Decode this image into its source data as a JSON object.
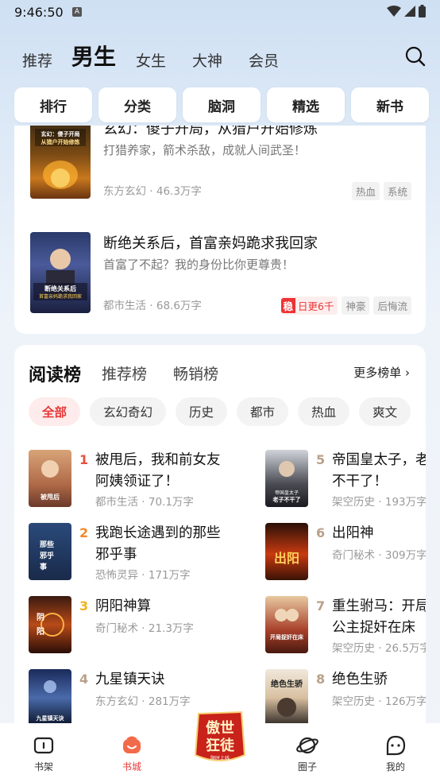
{
  "status_bar": {
    "time": "9:46:50",
    "notification": "A"
  },
  "top_tabs": {
    "items": [
      "推荐",
      "男生",
      "女生",
      "大神",
      "会员"
    ],
    "active_index": 1
  },
  "categories": [
    "排行",
    "分类",
    "脑洞",
    "精选",
    "新书"
  ],
  "featured_books": [
    {
      "title": "玄幻：傻子开局，从猎户开始修炼",
      "desc": "打猎养家，箭术杀敌，成就人间武圣！",
      "genre": "东方玄幻",
      "words": "46.3万字",
      "tags": [
        "热血",
        "系统"
      ],
      "cover_text": "玄幻：傻子开局 从猎户开始修炼"
    },
    {
      "title": "断绝关系后，首富亲妈跪求我回家",
      "desc": "首富了不起？我的身份比你更尊贵！",
      "genre": "都市生活",
      "words": "68.6万字",
      "badge_prefix": "稳",
      "badge": "日更6千",
      "tags": [
        "神豪",
        "后悔流"
      ],
      "cover_text": "断绝关系后 首富亲妈跪求我回家"
    }
  ],
  "ranking": {
    "tabs": [
      "阅读榜",
      "推荐榜",
      "畅销榜"
    ],
    "more": "更多榜单",
    "filters": [
      "全部",
      "玄幻奇幻",
      "历史",
      "都市",
      "热血",
      "爽文"
    ],
    "active_filter": 0,
    "left": [
      {
        "num": "1",
        "title": "被甩后，我和前女友阿姨领证了！",
        "meta": "都市生活 · 70.1万字",
        "color": "#e8503a"
      },
      {
        "num": "2",
        "title": "我跑长途遇到的那些邪乎事",
        "meta": "恐怖灵异 · 171万字",
        "color": "#f08a2a"
      },
      {
        "num": "3",
        "title": "阴阳神算",
        "meta": "奇门秘术 · 21.3万字",
        "color": "#f0b420"
      },
      {
        "num": "4",
        "title": "九星镇天诀",
        "meta": "东方玄幻 · 281万字",
        "color": "#b9a089"
      }
    ],
    "right": [
      {
        "num": "5",
        "title": "帝国皇太子，老不干了！",
        "meta": "架空历史 · 193万字",
        "color": "#b9a089"
      },
      {
        "num": "6",
        "title": "出阳神",
        "meta": "奇门秘术 · 309万字",
        "color": "#b9a089"
      },
      {
        "num": "7",
        "title": "重生驸马：开局公主捉奸在床",
        "meta": "架空历史 · 26.5万字",
        "color": "#b9a089"
      },
      {
        "num": "8",
        "title": "绝色生骄",
        "meta": "架空历史 · 126万字",
        "color": "#b9a089"
      }
    ]
  },
  "bottom_nav": {
    "items": [
      "书架",
      "书城",
      "圈子",
      "我的"
    ],
    "active_index": 1,
    "promo_text": "傲世狂徒",
    "promo_sub": "限时上线"
  },
  "colors": {
    "accent": "#e83a3a",
    "bg": "#dbe8f6"
  }
}
